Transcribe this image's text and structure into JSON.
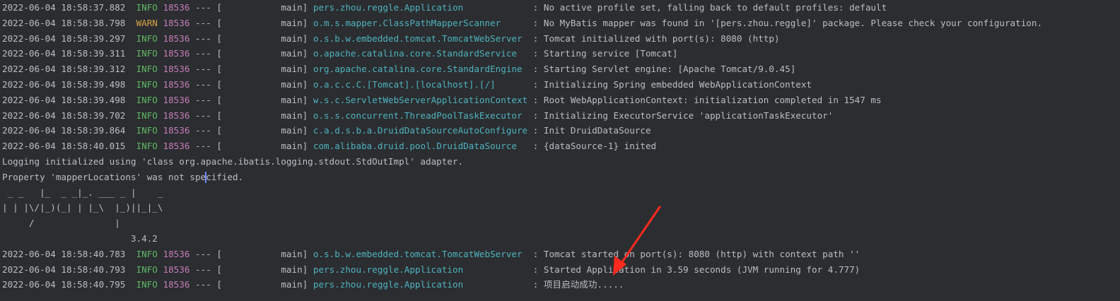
{
  "colors": {
    "background": "#2b2d30",
    "text": "#bcbec4",
    "info": "#5fb865",
    "warn": "#d9a343",
    "pid": "#c77dbb",
    "logger": "#4fb3bf",
    "annotation_arrow": "#ff2a1f"
  },
  "log_lines": [
    {
      "type": "log",
      "ts": "2022-06-04 18:58:37.882",
      "level": "INFO",
      "pid": "18536",
      "sep": "---",
      "thread": "[           main]",
      "logger": "pers.zhou.reggle.Application            ",
      "msg": ": No active profile set, falling back to default profiles: default"
    },
    {
      "type": "log",
      "ts": "2022-06-04 18:58:38.798",
      "level": "WARN",
      "pid": "18536",
      "sep": "---",
      "thread": "[           main]",
      "logger": "o.m.s.mapper.ClassPathMapperScanner     ",
      "msg": ": No MyBatis mapper was found in '[pers.zhou.reggle]' package. Please check your configuration."
    },
    {
      "type": "log",
      "ts": "2022-06-04 18:58:39.297",
      "level": "INFO",
      "pid": "18536",
      "sep": "---",
      "thread": "[           main]",
      "logger": "o.s.b.w.embedded.tomcat.TomcatWebServer ",
      "msg": ": Tomcat initialized with port(s): 8080 (http)"
    },
    {
      "type": "log",
      "ts": "2022-06-04 18:58:39.311",
      "level": "INFO",
      "pid": "18536",
      "sep": "---",
      "thread": "[           main]",
      "logger": "o.apache.catalina.core.StandardService  ",
      "msg": ": Starting service [Tomcat]"
    },
    {
      "type": "log",
      "ts": "2022-06-04 18:58:39.312",
      "level": "INFO",
      "pid": "18536",
      "sep": "---",
      "thread": "[           main]",
      "logger": "org.apache.catalina.core.StandardEngine ",
      "msg": ": Starting Servlet engine: [Apache Tomcat/9.0.45]"
    },
    {
      "type": "log",
      "ts": "2022-06-04 18:58:39.498",
      "level": "INFO",
      "pid": "18536",
      "sep": "---",
      "thread": "[           main]",
      "logger": "o.a.c.c.C.[Tomcat].[localhost].[/]      ",
      "msg": ": Initializing Spring embedded WebApplicationContext"
    },
    {
      "type": "log",
      "ts": "2022-06-04 18:58:39.498",
      "level": "INFO",
      "pid": "18536",
      "sep": "---",
      "thread": "[           main]",
      "logger": "w.s.c.ServletWebServerApplicationContext",
      "msg": ": Root WebApplicationContext: initialization completed in 1547 ms"
    },
    {
      "type": "log",
      "ts": "2022-06-04 18:58:39.702",
      "level": "INFO",
      "pid": "18536",
      "sep": "---",
      "thread": "[           main]",
      "logger": "o.s.s.concurrent.ThreadPoolTaskExecutor ",
      "msg": ": Initializing ExecutorService 'applicationTaskExecutor'"
    },
    {
      "type": "log",
      "ts": "2022-06-04 18:58:39.864",
      "level": "INFO",
      "pid": "18536",
      "sep": "---",
      "thread": "[           main]",
      "logger": "c.a.d.s.b.a.DruidDataSourceAutoConfigure",
      "msg": ": Init DruidDataSource"
    },
    {
      "type": "log",
      "ts": "2022-06-04 18:58:40.015",
      "level": "INFO",
      "pid": "18536",
      "sep": "---",
      "thread": "[           main]",
      "logger": "com.alibaba.druid.pool.DruidDataSource  ",
      "msg": ": {dataSource-1} inited"
    },
    {
      "type": "plain",
      "text": "Logging initialized using 'class org.apache.ibatis.logging.stdout.StdOutImpl' adapter."
    },
    {
      "type": "caret",
      "before": "Property 'mapperLocations' was not spe",
      "after": "cified."
    },
    {
      "type": "plain",
      "text": " _ _   |_  _ _|_. ___ _ |    _ "
    },
    {
      "type": "plain",
      "text": "| | |\\/|_)(_| | |_\\  |_)||_|_\\ "
    },
    {
      "type": "plain",
      "text": "     /               |         "
    },
    {
      "type": "plain",
      "text": "                        3.4.2 "
    },
    {
      "type": "log",
      "ts": "2022-06-04 18:58:40.783",
      "level": "INFO",
      "pid": "18536",
      "sep": "---",
      "thread": "[           main]",
      "logger": "o.s.b.w.embedded.tomcat.TomcatWebServer ",
      "msg": ": Tomcat started on port(s): 8080 (http) with context path ''"
    },
    {
      "type": "log",
      "ts": "2022-06-04 18:58:40.793",
      "level": "INFO",
      "pid": "18536",
      "sep": "---",
      "thread": "[           main]",
      "logger": "pers.zhou.reggle.Application            ",
      "msg": ": Started Application in 3.59 seconds (JVM running for 4.777)"
    },
    {
      "type": "log",
      "ts": "2022-06-04 18:58:40.795",
      "level": "INFO",
      "pid": "18536",
      "sep": "---",
      "thread": "[           main]",
      "logger": "pers.zhou.reggle.Application            ",
      "msg": ": 项目启动成功....."
    }
  ]
}
